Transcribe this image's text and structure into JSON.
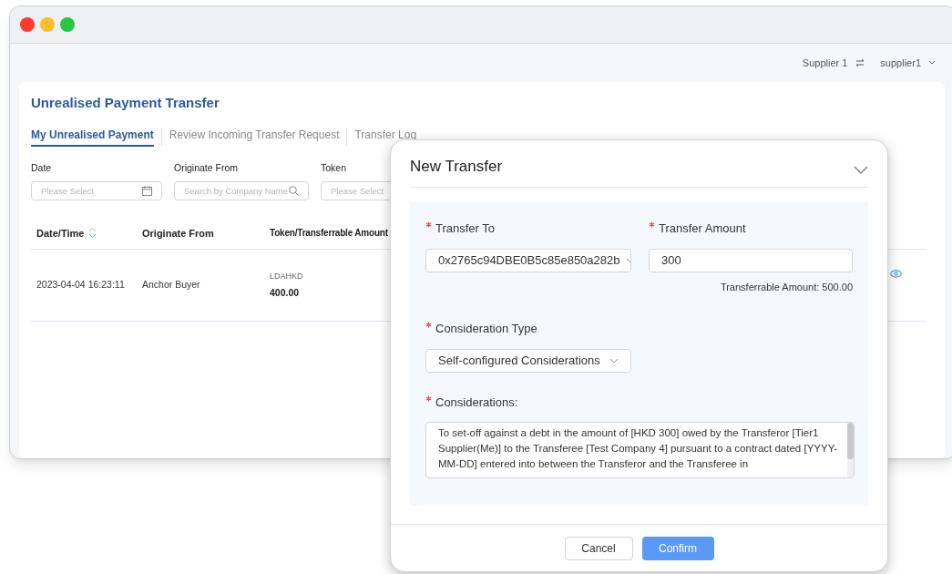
{
  "header": {
    "company": "Supplier 1",
    "user": "supplier1"
  },
  "page": {
    "title": "Unrealised Payment Transfer",
    "tabs": [
      {
        "label": "My Unrealised Payment",
        "selected": true
      },
      {
        "label": "Review Incoming Transfer Request",
        "selected": false
      },
      {
        "label": "Transfer Log",
        "selected": false
      }
    ],
    "filters": [
      {
        "label": "Date",
        "placeholder": "Please Select",
        "kind": "date"
      },
      {
        "label": "Originate From",
        "placeholder": "Search by Company Name",
        "kind": "search"
      },
      {
        "label": "Token",
        "placeholder": "Please Select",
        "kind": "select"
      }
    ],
    "table": {
      "columns": [
        {
          "label": "Date/Time",
          "sortable": true
        },
        {
          "label": "Originate From",
          "sortable": false
        },
        {
          "label": "Token/Transferrable Amount"
        }
      ],
      "rows": [
        {
          "date_time": "2023-04-04 16:23:11",
          "originate_from": "Anchor Buyer",
          "token": "LDAHKD",
          "amount": "400.00"
        }
      ]
    }
  },
  "modal": {
    "title": "New Transfer",
    "transfer_to": {
      "label": "Transfer To",
      "value": "0x2765c94DBE0B5c85e850a282b",
      "required": true
    },
    "transfer_amount": {
      "label": "Transfer Amount",
      "value": "300",
      "required": true,
      "note": "Transferrable Amount: 500.00"
    },
    "consideration_type": {
      "label": "Consideration Type",
      "value": "Self-configured Considerations",
      "required": true
    },
    "considerations": {
      "label": "Considerations:",
      "value": "To set-off against a debt in the amount of [HKD 300] owed by the Transferor [Tier1 Supplier(Me)] to the Transferee [Test Company 4] pursuant to a contract dated [YYYY-MM-DD] entered into between the Transferor and the Transferee in",
      "required": true
    },
    "buttons": [
      {
        "label": "Cancel",
        "kind": "secondary"
      },
      {
        "label": "Confirm",
        "kind": "primary"
      }
    ]
  }
}
